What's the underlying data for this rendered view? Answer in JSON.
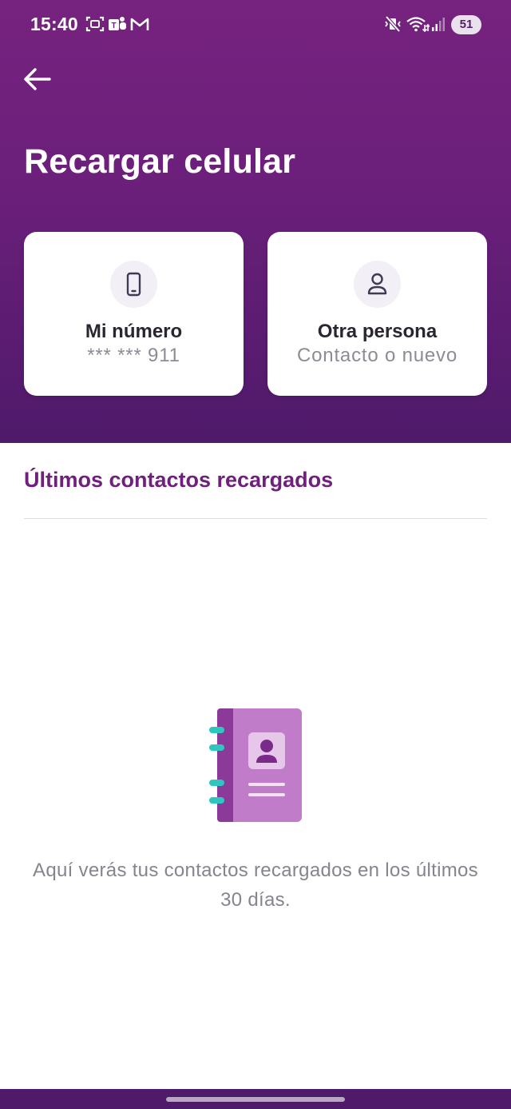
{
  "status_bar": {
    "time": "15:40",
    "notification_icons": [
      "screenshot-icon",
      "teams-icon",
      "gmail-icon"
    ],
    "system_icons": [
      "vibrate-mute-icon",
      "wifi-icon",
      "signal-icon"
    ],
    "battery": "51"
  },
  "header": {
    "back_icon": "arrow-left-icon",
    "title": "Recargar celular",
    "background_color": "#6a1f7a"
  },
  "options": [
    {
      "icon": "smartphone-icon",
      "title": "Mi número",
      "subtitle": "*** *** 911"
    },
    {
      "icon": "person-icon",
      "title": "Otra persona",
      "subtitle": "Contacto o nuevo"
    }
  ],
  "recent": {
    "title": "Últimos contactos recargados",
    "empty_icon": "contact-book-icon",
    "empty_message": "Aquí verás tus contactos recargados en los últimos 30 días."
  },
  "colors": {
    "accent": "#6f1f7c",
    "illustration_purple": "#c07cc8",
    "illustration_dark": "#8b3a9a",
    "illustration_teal": "#2ec7c0"
  }
}
